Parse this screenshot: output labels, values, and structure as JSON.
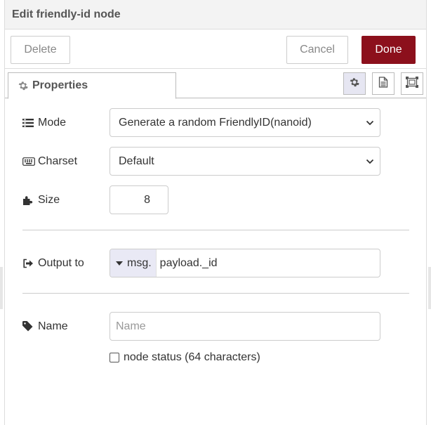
{
  "tray": {
    "title": "Edit friendly-id node"
  },
  "toolbar": {
    "delete_label": "Delete",
    "cancel_label": "Cancel",
    "done_label": "Done"
  },
  "tabs": {
    "properties_label": "Properties",
    "icons": [
      "gear-icon",
      "description-icon",
      "appearance-icon"
    ]
  },
  "form": {
    "mode": {
      "label": "Mode",
      "value": "Generate a random FriendlyID(nanoid)"
    },
    "charset": {
      "label": "Charset",
      "value": "Default"
    },
    "size": {
      "label": "Size",
      "value": "8"
    },
    "output": {
      "label": "Output to",
      "type": "msg.",
      "value": "payload._id"
    },
    "name": {
      "label": "Name",
      "placeholder": "Name",
      "value": ""
    },
    "node_status": {
      "label": "node status (64 characters)",
      "checked": false
    }
  },
  "colors": {
    "accent": "#8c101c",
    "header_bg": "#f3f3f3",
    "type_bg": "#e9e9f5"
  }
}
